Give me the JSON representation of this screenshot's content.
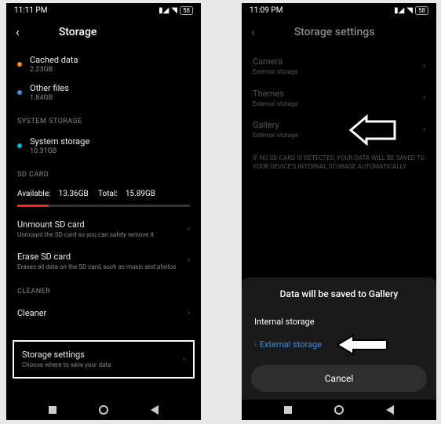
{
  "left": {
    "status": {
      "time": "11:11 PM",
      "battery": "58"
    },
    "title": "Storage",
    "cached": {
      "label": "Cached data",
      "sub": "2.23GB"
    },
    "other": {
      "label": "Other files",
      "sub": "1.84GB"
    },
    "section_system": "SYSTEM STORAGE",
    "system": {
      "label": "System storage",
      "sub": "10.31GB"
    },
    "section_sd": "SD CARD",
    "sd": {
      "available_label": "Available:",
      "available": "13.36GB",
      "total_label": "Total:",
      "total": "15.89GB"
    },
    "unmount": {
      "label": "Unmount SD card",
      "sub": "Unmount the SD card so you can safely remove it"
    },
    "erase": {
      "label": "Erase SD card",
      "sub": "Erases all data on the SD card, such as music and photos"
    },
    "section_cleaner": "CLEANER",
    "cleaner": {
      "label": "Cleaner"
    },
    "storage_settings": {
      "label": "Storage settings",
      "sub": "Choose where to save your data"
    }
  },
  "right": {
    "status": {
      "time": "11:09 PM",
      "battery": "58"
    },
    "title": "Storage settings",
    "camera": {
      "label": "Camera",
      "sub": "External storage"
    },
    "themes": {
      "label": "Themes",
      "sub": "External storage"
    },
    "gallery": {
      "label": "Gallery",
      "sub": "External storage"
    },
    "note": "IF NO SD CARD IS DETECTED, YOUR DATA WILL BE SAVED TO YOUR DEVICE'S INTERNAL STORAGE AUTOMATICALLY",
    "sheet": {
      "title": "Data will be saved to Gallery",
      "internal": "Internal storage",
      "external": "External storage",
      "cancel": "Cancel"
    }
  }
}
